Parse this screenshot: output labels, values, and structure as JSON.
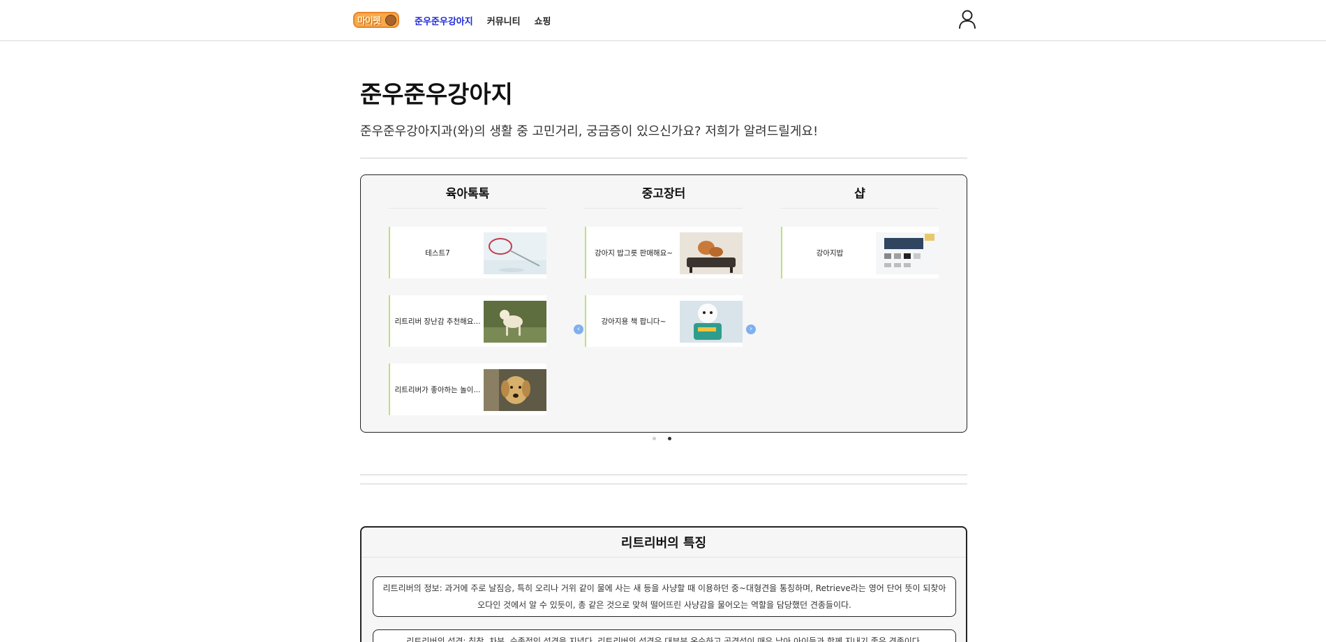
{
  "header": {
    "logo_text": "마이펫",
    "nav": [
      "준우준우강아지",
      "커뮤니티",
      "쇼핑"
    ],
    "active_nav": 0,
    "user_icon": "user-icon"
  },
  "page": {
    "title": "준우준우강아지",
    "subtitle": "준우준우강아지과(와)의 생활 중 고민거리, 궁금증이 있으신가요? 저희가 알려드릴게요!"
  },
  "carousel": {
    "columns": [
      {
        "title": "육아톡톡",
        "cards": [
          {
            "label": "테스트7",
            "thumb": "badminton-racket"
          },
          {
            "label": "리트리버 장난감 추천해요...",
            "thumb": "dog-lawn"
          },
          {
            "label": "리트리버가 좋아하는 놀이...",
            "thumb": "golden-retriever"
          }
        ]
      },
      {
        "title": "중고장터",
        "cards": [
          {
            "label": "강아지 밥그릇 판매해요~",
            "thumb": "dog-bowl"
          },
          {
            "label": "강아지용 책 팝니다~",
            "thumb": "white-puppy"
          }
        ]
      },
      {
        "title": "샵",
        "cards": [
          {
            "label": "강아지밥",
            "thumb": "shop-screenshot"
          }
        ]
      }
    ],
    "prev_icon": "chevron-left-icon",
    "next_icon": "chevron-right-icon",
    "pages": 2,
    "active_page": 1
  },
  "retriever": {
    "title": "리트리버의 특징",
    "info": "리트리버의 정보: 과거에 주로 날짐승, 특히 오리나 거위 같이 물에 사는 새 등을 사냥할 때 이용하던 중~대형견을 통칭하며, Retrieve라는 영어 단어 뜻이 되찾아오다인 것에서 알 수 있듯이, 총 같은 것으로 맞혀 떨어뜨린 사냥감을 물어오는 역할을 담당했던 견종들이다.",
    "info2": "리트리버의 성격: 침착, 차분, 순종적인 성격을 지녔다. 리트리버의 성격은 대부분 온순하고 공격성이 매우 낮아 아이들과 함께 지내기 좋은 견종이다."
  },
  "colors": {
    "accent": "#1f2ad8",
    "card_border": "#b9e27a",
    "panel_bg": "#f6f6f6",
    "arrow": "#7fb0f0"
  }
}
